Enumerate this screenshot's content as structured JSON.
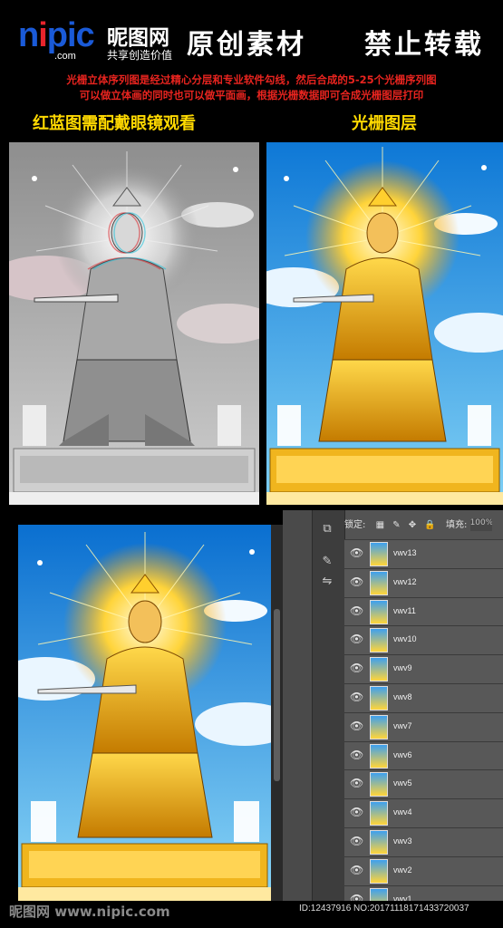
{
  "header": {
    "logo_main": "nipic",
    "logo_domain": ".com",
    "brand_name": "昵图网",
    "brand_slogan": "共享创造价值",
    "banner_left": "原创素材",
    "banner_right": "禁止转载"
  },
  "description": {
    "line1": "光栅立体序列图是经过精心分层和专业软件勾线，然后合成的5-25个光栅序列图",
    "line2": "可以做立体画的同时也可以做平面画，根据光栅数据即可合成光栅图层打印"
  },
  "captions": {
    "left": "红蓝图需配戴眼镜观看",
    "right": "光栅图层"
  },
  "photoshop": {
    "lock_label": "锁定:",
    "fill_label": "填充:",
    "fill_value": "100%",
    "tool_icons": [
      "layers-icon",
      "brush-icon",
      "adjust-icon"
    ],
    "layers": [
      {
        "name": "vwv13",
        "visible": true
      },
      {
        "name": "vwv12",
        "visible": true
      },
      {
        "name": "vwv11",
        "visible": true
      },
      {
        "name": "vwv10",
        "visible": true
      },
      {
        "name": "vwv9",
        "visible": true
      },
      {
        "name": "vwv8",
        "visible": true
      },
      {
        "name": "vwv7",
        "visible": true
      },
      {
        "name": "vwv6",
        "visible": true
      },
      {
        "name": "vwv5",
        "visible": true
      },
      {
        "name": "vwv4",
        "visible": true
      },
      {
        "name": "vwv3",
        "visible": true
      },
      {
        "name": "vwv2",
        "visible": true
      },
      {
        "name": "vwv1",
        "visible": true
      }
    ]
  },
  "footer": {
    "watermark": "昵图网 www.nipic.com",
    "id_text": "ID:12437916 NO:20171118171433720037"
  },
  "colors": {
    "accent_red": "#e8241f",
    "caption_yellow": "#ffd900",
    "logo_blue": "#1a5ad8",
    "ps_panel": "#535353"
  }
}
